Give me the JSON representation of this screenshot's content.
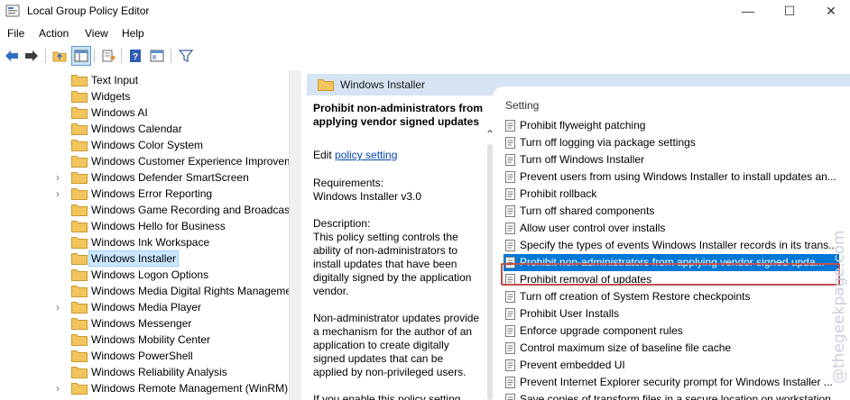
{
  "window": {
    "title": "Local Group Policy Editor",
    "minimize_glyph": "—",
    "maximize_glyph": "☐",
    "close_glyph": "✕"
  },
  "menu": [
    "File",
    "Action",
    "View",
    "Help"
  ],
  "toolbar": {
    "icons": [
      "back-arrow-icon",
      "forward-arrow-icon",
      "up-folder-icon",
      "show-hide-tree-icon",
      "export-list-icon",
      "help-icon",
      "properties-icon",
      "filter-icon"
    ]
  },
  "tree": {
    "items": [
      {
        "label": "Text Input",
        "expandable": false,
        "selected": false
      },
      {
        "label": "Widgets",
        "expandable": false,
        "selected": false
      },
      {
        "label": "Windows AI",
        "expandable": false,
        "selected": false
      },
      {
        "label": "Windows Calendar",
        "expandable": false,
        "selected": false
      },
      {
        "label": "Windows Color System",
        "expandable": false,
        "selected": false
      },
      {
        "label": "Windows Customer Experience Improvement Program",
        "expandable": false,
        "selected": false
      },
      {
        "label": "Windows Defender SmartScreen",
        "expandable": true,
        "selected": false
      },
      {
        "label": "Windows Error Reporting",
        "expandable": true,
        "selected": false
      },
      {
        "label": "Windows Game Recording and Broadcasting",
        "expandable": false,
        "selected": false
      },
      {
        "label": "Windows Hello for Business",
        "expandable": false,
        "selected": false
      },
      {
        "label": "Windows Ink Workspace",
        "expandable": false,
        "selected": false
      },
      {
        "label": "Windows Installer",
        "expandable": false,
        "selected": true
      },
      {
        "label": "Windows Logon Options",
        "expandable": false,
        "selected": false
      },
      {
        "label": "Windows Media Digital Rights Management",
        "expandable": false,
        "selected": false
      },
      {
        "label": "Windows Media Player",
        "expandable": true,
        "selected": false
      },
      {
        "label": "Windows Messenger",
        "expandable": false,
        "selected": false
      },
      {
        "label": "Windows Mobility Center",
        "expandable": false,
        "selected": false
      },
      {
        "label": "Windows PowerShell",
        "expandable": false,
        "selected": false
      },
      {
        "label": "Windows Reliability Analysis",
        "expandable": false,
        "selected": false
      },
      {
        "label": "Windows Remote Management (WinRM)",
        "expandable": true,
        "selected": false
      }
    ]
  },
  "details": {
    "header_title": "Windows Installer",
    "policy_title": "Prohibit non-administrators from applying vendor signed updates",
    "edit_prefix": "Edit ",
    "edit_link": "policy setting ",
    "requirements_label": "Requirements:",
    "requirements_value": "Windows Installer v3.0",
    "description_label": "Description:",
    "description_text": "This policy setting controls the ability of non-administrators to install updates that have been digitally signed by the application vendor.",
    "description_text_2": "Non-administrator updates provide a mechanism for the author of an application to create digitally signed updates that can be applied by non-privileged users.",
    "description_text_3": "If you enable this policy setting,",
    "scroll_up_glyph": "⌃"
  },
  "settings": {
    "column_header": "Setting",
    "items": [
      {
        "label": "Prohibit flyweight patching",
        "selected": false
      },
      {
        "label": "Turn off logging via package settings",
        "selected": false
      },
      {
        "label": "Turn off Windows Installer",
        "selected": false
      },
      {
        "label": "Prevent users from using Windows Installer to install updates an...",
        "selected": false
      },
      {
        "label": "Prohibit rollback",
        "selected": false
      },
      {
        "label": "Turn off shared components",
        "selected": false
      },
      {
        "label": "Allow user control over installs",
        "selected": false
      },
      {
        "label": "Specify the types of events Windows Installer records in its trans...",
        "selected": false
      },
      {
        "label": "Prohibit non-administrators from applying vendor signed upda...",
        "selected": true
      },
      {
        "label": "Prohibit removal of updates",
        "selected": false
      },
      {
        "label": "Turn off creation of System Restore checkpoints",
        "selected": false
      },
      {
        "label": "Prohibit User Installs",
        "selected": false
      },
      {
        "label": "Enforce upgrade component rules",
        "selected": false
      },
      {
        "label": "Control maximum size of baseline file cache",
        "selected": false
      },
      {
        "label": "Prevent embedded UI",
        "selected": false
      },
      {
        "label": "Prevent Internet Explorer security prompt for Windows Installer ...",
        "selected": false
      },
      {
        "label": "Save copies of transform files in a secure location on workstation",
        "selected": false
      }
    ]
  },
  "watermark": "@thegeekpage.com",
  "colors": {
    "selection": "#0078d7",
    "header_band": "#d6e3f2",
    "highlight_border": "#c0504d",
    "folder": "#f2c45c",
    "link": "#0645ad"
  }
}
